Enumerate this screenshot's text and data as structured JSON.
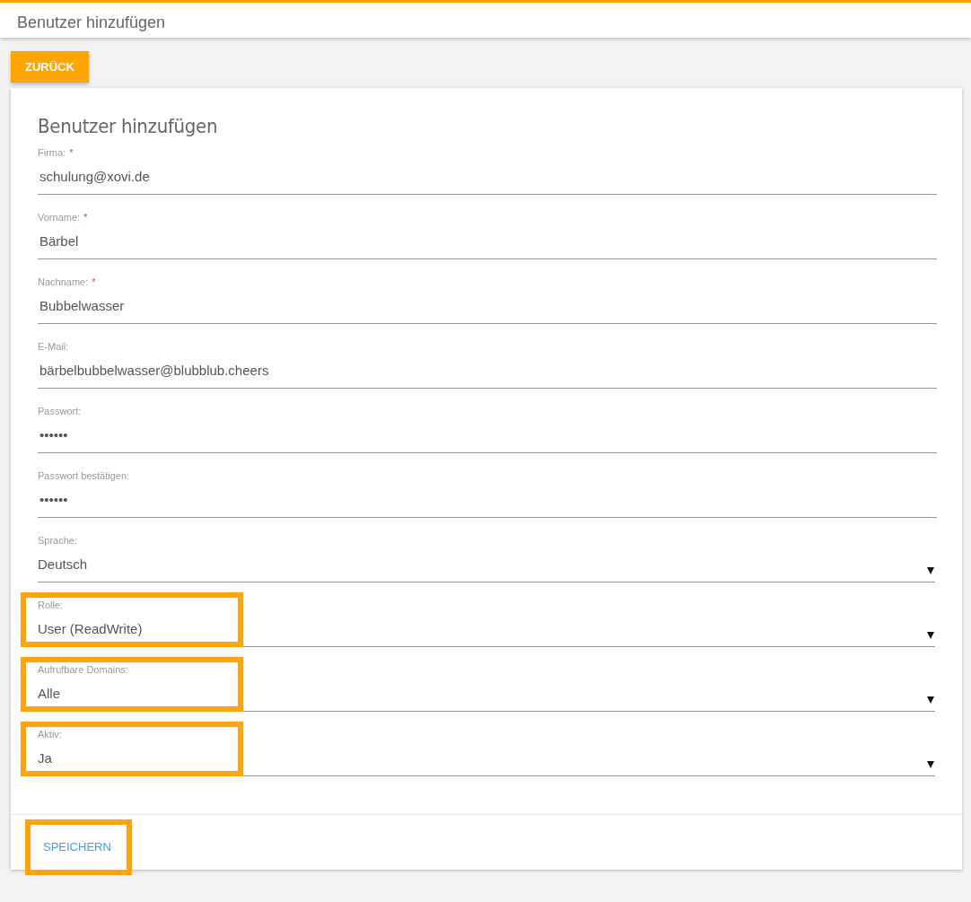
{
  "header": {
    "title": "Benutzer hinzufügen"
  },
  "back_button": {
    "label": "ZURÜCK"
  },
  "form": {
    "title": "Benutzer hinzufügen",
    "fields": [
      {
        "kind": "text",
        "label": "Firma:",
        "required_mark": "*",
        "value": "schulung@xovi.de",
        "highlighted": false
      },
      {
        "kind": "text",
        "label": "Vorname:",
        "required_mark": "*",
        "value": "Bärbel",
        "highlighted": false
      },
      {
        "kind": "text",
        "label": "Nachname:",
        "required_mark": "*",
        "value": "Bubbelwasser",
        "highlighted": false
      },
      {
        "kind": "text",
        "label": "E-Mail:",
        "value": "bärbelbubbelwasser@blubblub.cheers",
        "highlighted": false
      },
      {
        "kind": "password",
        "label": "Passwort:",
        "value": "••••••",
        "highlighted": false
      },
      {
        "kind": "password",
        "label": "Passwort bestätigen:",
        "value": "••••••",
        "highlighted": false
      },
      {
        "kind": "select",
        "label": "Sprache:",
        "value": "Deutsch",
        "highlighted": false
      },
      {
        "kind": "select",
        "label": "Rolle:",
        "value": "User (ReadWrite)",
        "highlighted": true
      },
      {
        "kind": "select",
        "label": "Aufrufbare Domains:",
        "value": "Alle",
        "highlighted": true
      },
      {
        "kind": "select",
        "label": "Aktiv:",
        "value": "Ja",
        "highlighted": true
      }
    ],
    "save_button": {
      "label": "SPEICHERN",
      "highlighted": true
    }
  }
}
